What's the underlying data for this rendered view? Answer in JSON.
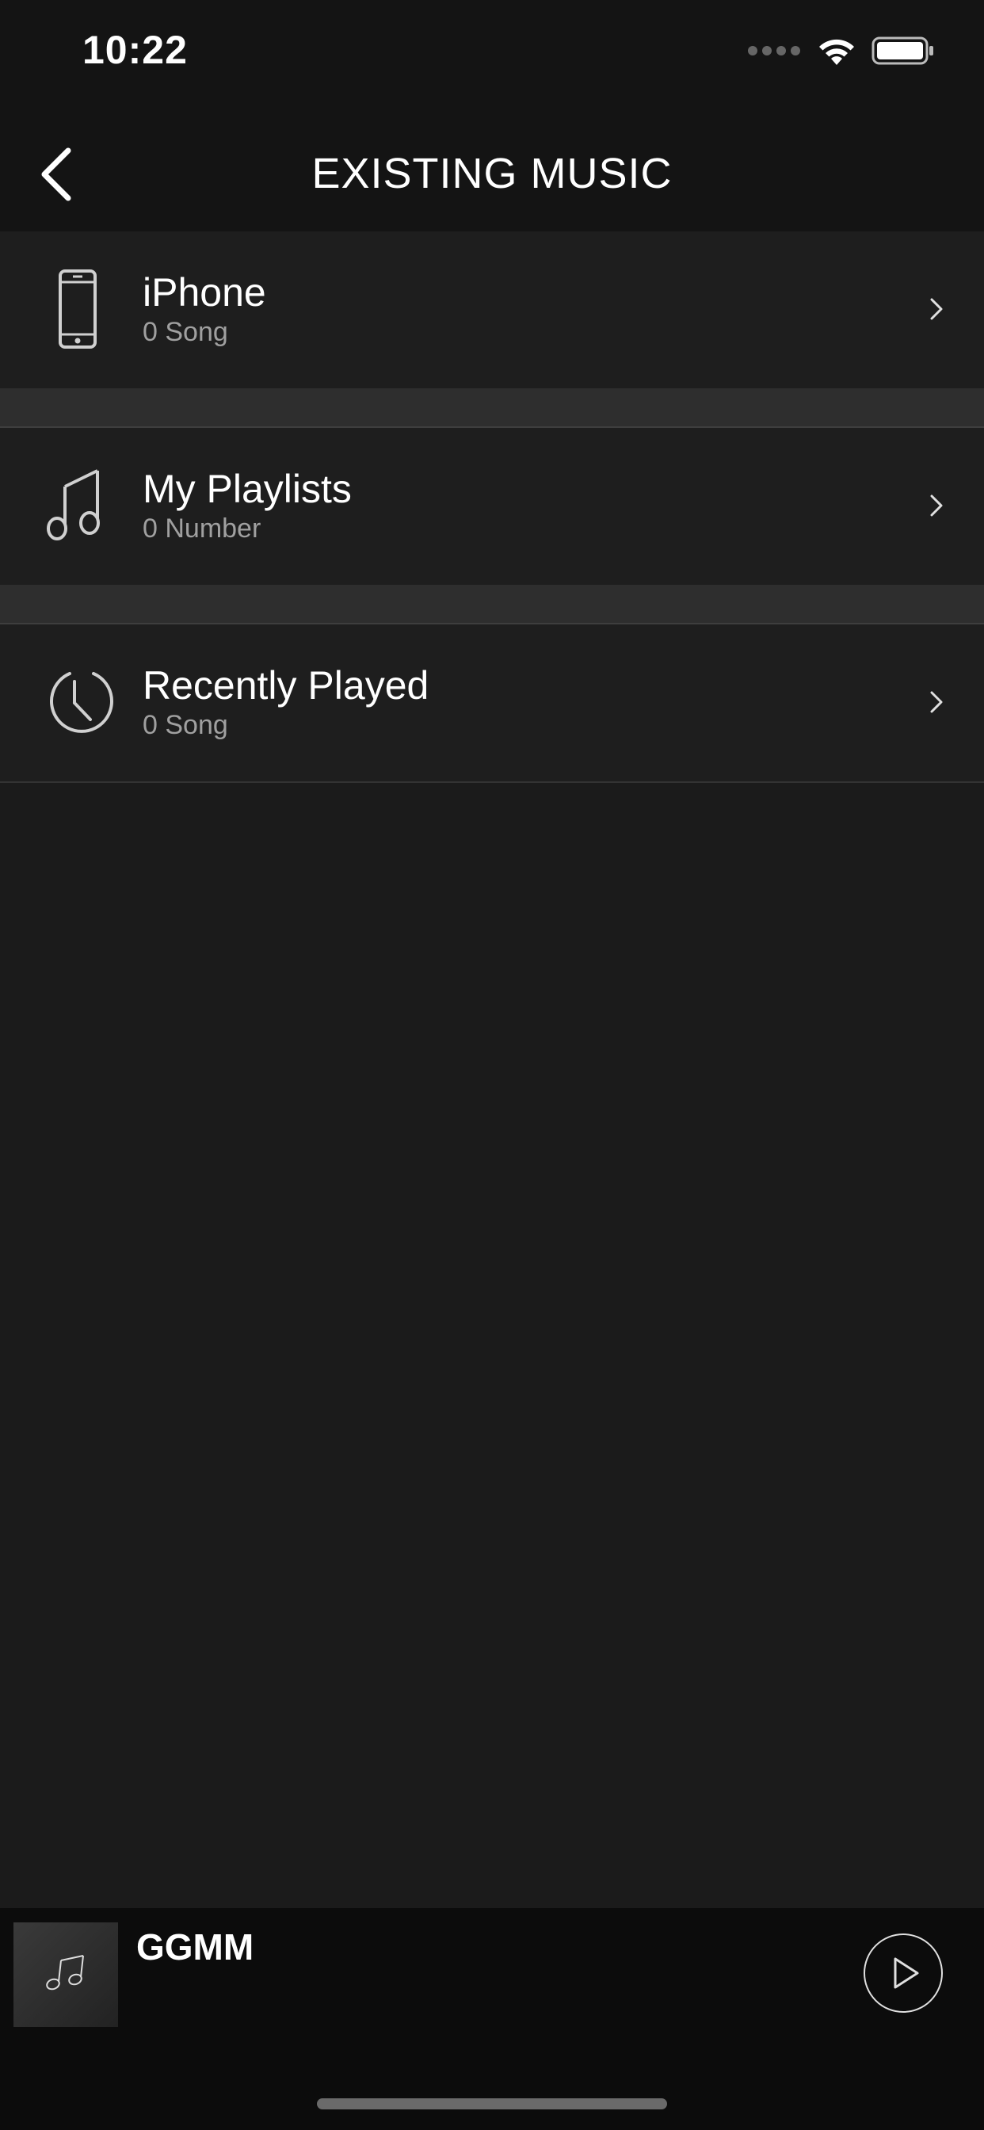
{
  "status_bar": {
    "time": "10:22"
  },
  "nav": {
    "title": "EXISTING MUSIC",
    "back_icon": "chevron-left-icon"
  },
  "list": [
    {
      "title": "iPhone",
      "subtitle": "0 Song",
      "icon": "phone-icon"
    },
    {
      "title": "My Playlists",
      "subtitle": "0 Number",
      "icon": "music-note-icon"
    },
    {
      "title": "Recently Played",
      "subtitle": "0 Song",
      "icon": "clock-icon"
    }
  ],
  "player": {
    "title": "GGMM",
    "play_icon": "play-icon",
    "art_icon": "music-note-icon"
  },
  "colors": {
    "background": "#1b1b1b",
    "bar": "#141414",
    "row": "#1e1e1e",
    "separator": "#2e2e2e",
    "subtitle": "#a0a0a0"
  }
}
